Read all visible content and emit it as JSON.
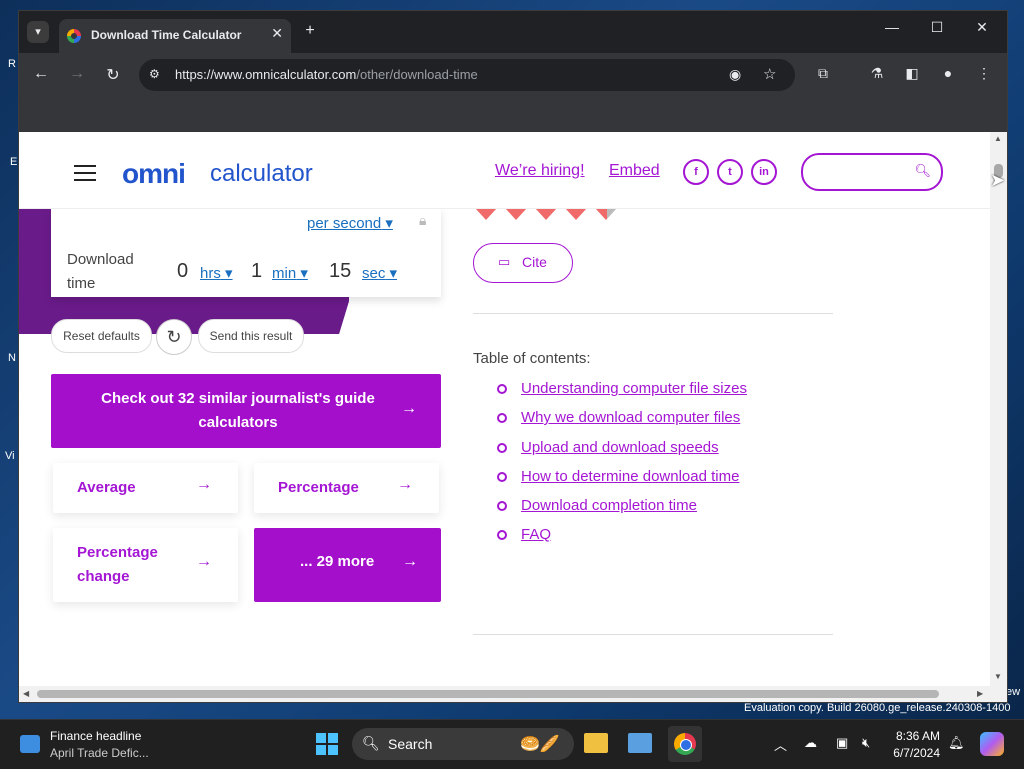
{
  "browser": {
    "tab_title": "Download Time Calculator",
    "url_host": "https://www.omnicalculator.com",
    "url_path": "/other/download-time"
  },
  "site": {
    "logo_omni": "omni",
    "logo_calculator": "calculator",
    "hiring_label": "We’re hiring!",
    "embed_label": "Embed",
    "social": [
      "f",
      "t",
      "in"
    ]
  },
  "calculator": {
    "per_second_label": "per second",
    "download_time_label": "Download time",
    "hours_value": "0",
    "hours_unit": "hrs",
    "minutes_value": "1",
    "minutes_unit": "min",
    "seconds_value": "15",
    "seconds_unit": "sec",
    "reset_label": "Reset defaults",
    "send_label": "Send this result"
  },
  "related": {
    "similar_label": "Check out 32 similar journalist's guide calculators",
    "cards": [
      "Average",
      "Percentage",
      "Percentage change"
    ],
    "more_label": "... 29 more"
  },
  "article": {
    "cite_label": "Cite",
    "toc_title": "Table of contents:",
    "toc": [
      "Understanding computer file sizes",
      "Why we download computer files",
      "Upload and download speeds",
      "How to determine download time",
      "Download completion time",
      "FAQ"
    ]
  },
  "taskbar": {
    "news_title": "Finance headline",
    "news_sub": "April Trade Defic...",
    "search_label": "Search",
    "time": "8:36 AM",
    "date": "6/7/2024",
    "eval_text": "Evaluation copy. Build 26080.ge_release.240308-1400"
  },
  "desktop": {
    "left_labels": [
      "R",
      "E",
      "N",
      "Vi"
    ],
    "right_label": "ew"
  }
}
